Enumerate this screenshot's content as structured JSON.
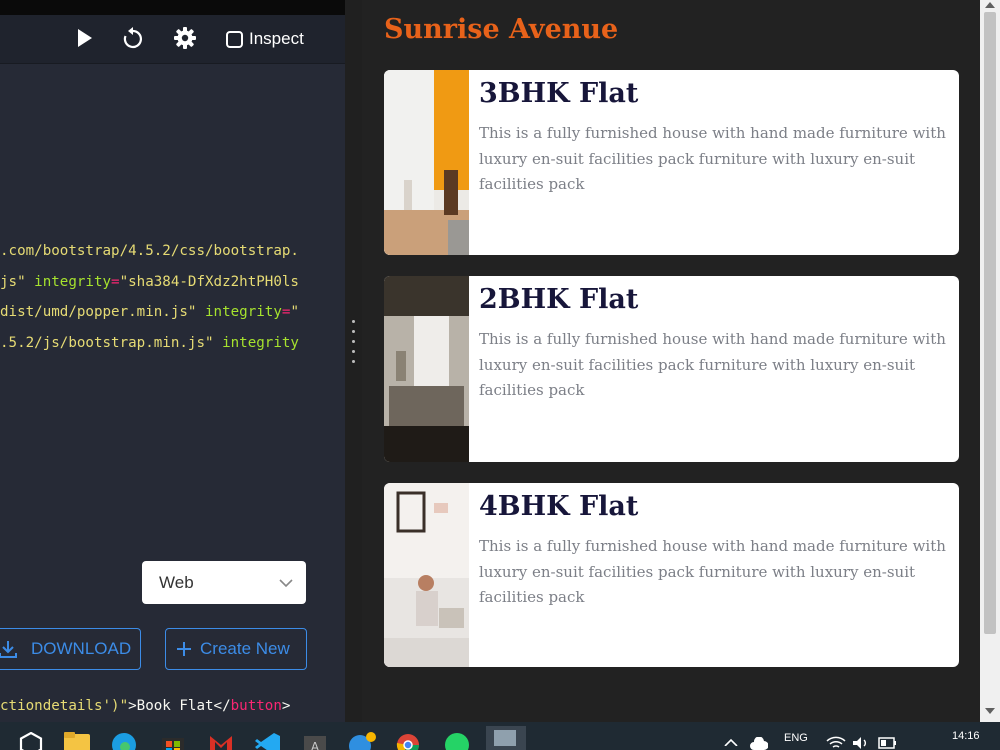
{
  "editor": {
    "toolbar": {
      "inspect_label": "Inspect",
      "icons": [
        "play-icon",
        "refresh-icon",
        "gear-icon"
      ]
    },
    "code_lines": [
      [
        {
          "t": ".com/bootstrap/4.5.2/css/bootstrap.",
          "c": "str"
        }
      ],
      [
        {
          "t": "js\"",
          "c": "str"
        },
        {
          "t": " integrity",
          "c": "attr"
        },
        {
          "t": "=",
          "c": "op"
        },
        {
          "t": "\"sha384-DfXdz2htPH0ls",
          "c": "str"
        }
      ],
      [
        {
          "t": "dist/umd/popper.min.js\"",
          "c": "str"
        },
        {
          "t": " integrity",
          "c": "attr"
        },
        {
          "t": "=",
          "c": "op"
        },
        {
          "t": "\"",
          "c": "str"
        }
      ],
      [
        {
          "t": ".5.2/js/bootstrap.min.js\"",
          "c": "str"
        },
        {
          "t": " integrity",
          "c": "attr"
        }
      ]
    ],
    "bottom_line": [
      {
        "t": "ctiondetails')\"",
        "c": "str"
      },
      {
        "t": ">Book Flat</",
        "c": "w"
      },
      {
        "t": "button",
        "c": "op"
      },
      {
        "t": ">",
        "c": "w"
      }
    ],
    "view_select": {
      "value": "Web"
    },
    "download_label": "DOWNLOAD",
    "create_label": "Create New"
  },
  "preview": {
    "title": "Sunrise Avenue",
    "cards": [
      {
        "title": "3BHK Flat",
        "text": "This is a fully furnished house with hand made furniture with luxury en-suit facilities pack furniture with luxury en-suit facilities pack"
      },
      {
        "title": "2BHK Flat",
        "text": "This is a fully furnished house with hand made furniture with luxury en-suit facilities pack furniture with luxury en-suit facilities pack"
      },
      {
        "title": "4BHK Flat",
        "text": "This is a fully furnished house with hand made furniture with luxury en-suit facilities pack furniture with luxury en-suit facilities pack"
      }
    ]
  },
  "taskbar": {
    "language": "ENG",
    "time": "14:16"
  },
  "colors": {
    "accent_orange": "#e8621a",
    "link_blue": "#3c8ce7",
    "card_title": "#17163a"
  }
}
